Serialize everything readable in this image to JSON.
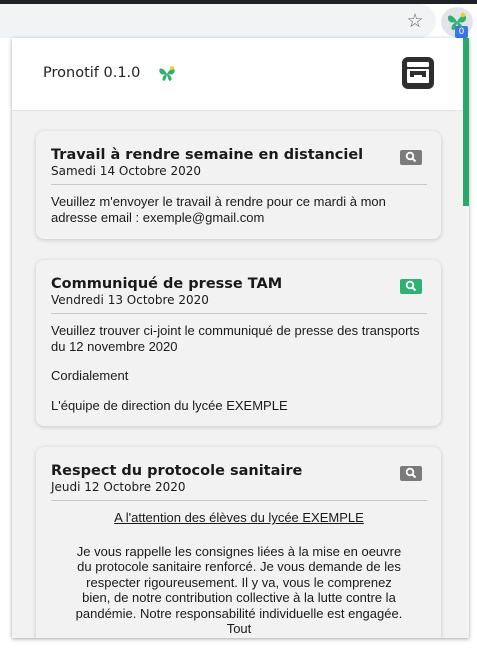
{
  "browser": {
    "star_icon": "star-outline-icon",
    "extension_icon": "butterfly-icon",
    "extension_badge": "0"
  },
  "header": {
    "app_title": "Pronotif 0.1.0",
    "logo_icon": "butterfly-logo-icon",
    "inbox_icon": "inbox-tray-icon"
  },
  "colors": {
    "accent": "#2fb173",
    "scroll_thumb": "#28a96b",
    "view_default": "#7b7b7b"
  },
  "cards": [
    {
      "title": "Travail à rendre semaine en distanciel",
      "date": "Samedi 14 Octobre 2020",
      "view_state": "grey",
      "body": [
        "Veuillez m'envoyer le travail à rendre pour ce mardi à mon adresse email : exemple@gmail.com"
      ]
    },
    {
      "title": "Communiqué de presse TAM",
      "date": "Vendredi 13 Octobre 2020",
      "view_state": "green",
      "body": [
        "Veuillez trouver ci-joint le communiqué de presse des transports du 12 novembre 2020",
        "Cordialement",
        "L'équipe de direction du lycée EXEMPLE"
      ]
    },
    {
      "title": "Respect du protocole sanitaire",
      "date": "Jeudi 12 Octobre 2020",
      "view_state": "grey",
      "heading": "A l'attention des élèves du lycée EXEMPLE",
      "body": [
        "Je vous rappelle les consignes liées à la mise en oeuvre du protocole sanitaire renforcé. Je vous demande de les respecter rigoureusement. Il y va, vous le comprenez bien, de notre contribution collective à la lutte contre la pandémie. Notre responsabilité individuelle est engagée. Tout"
      ]
    }
  ]
}
